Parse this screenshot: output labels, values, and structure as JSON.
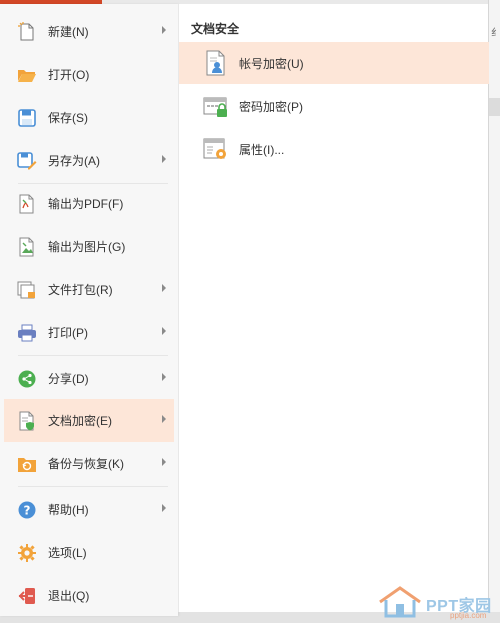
{
  "menu": {
    "items": [
      {
        "label": "新建(N)",
        "icon": "new-file-icon",
        "has_submenu": true
      },
      {
        "label": "打开(O)",
        "icon": "folder-open-icon",
        "has_submenu": false
      },
      {
        "label": "保存(S)",
        "icon": "save-icon",
        "has_submenu": false
      },
      {
        "label": "另存为(A)",
        "icon": "save-as-icon",
        "has_submenu": true
      },
      {
        "label": "输出为PDF(F)",
        "icon": "pdf-export-icon",
        "has_submenu": false
      },
      {
        "label": "输出为图片(G)",
        "icon": "image-export-icon",
        "has_submenu": false
      },
      {
        "label": "文件打包(R)",
        "icon": "package-icon",
        "has_submenu": true
      },
      {
        "label": "打印(P)",
        "icon": "printer-icon",
        "has_submenu": true
      },
      {
        "label": "分享(D)",
        "icon": "share-icon",
        "has_submenu": true
      },
      {
        "label": "文档加密(E)",
        "icon": "document-lock-icon",
        "has_submenu": true,
        "active": true
      },
      {
        "label": "备份与恢复(K)",
        "icon": "backup-icon",
        "has_submenu": true
      },
      {
        "label": "帮助(H)",
        "icon": "help-icon",
        "has_submenu": true
      },
      {
        "label": "选项(L)",
        "icon": "gear-icon",
        "has_submenu": false
      },
      {
        "label": "退出(Q)",
        "icon": "exit-icon",
        "has_submenu": false
      }
    ]
  },
  "submenu": {
    "title": "文档安全",
    "items": [
      {
        "label": "帐号加密(U)",
        "icon": "account-lock-icon",
        "active": true
      },
      {
        "label": "密码加密(P)",
        "icon": "password-lock-icon"
      },
      {
        "label": "属性(I)...",
        "icon": "properties-icon"
      }
    ]
  },
  "watermark": {
    "text": "PPT家园",
    "sub": "pptjia.com"
  },
  "colors": {
    "accent": "#d24726",
    "highlight": "#fde6d8",
    "panel_left": "#f7f7f7",
    "panel_right": "#ffffff"
  }
}
